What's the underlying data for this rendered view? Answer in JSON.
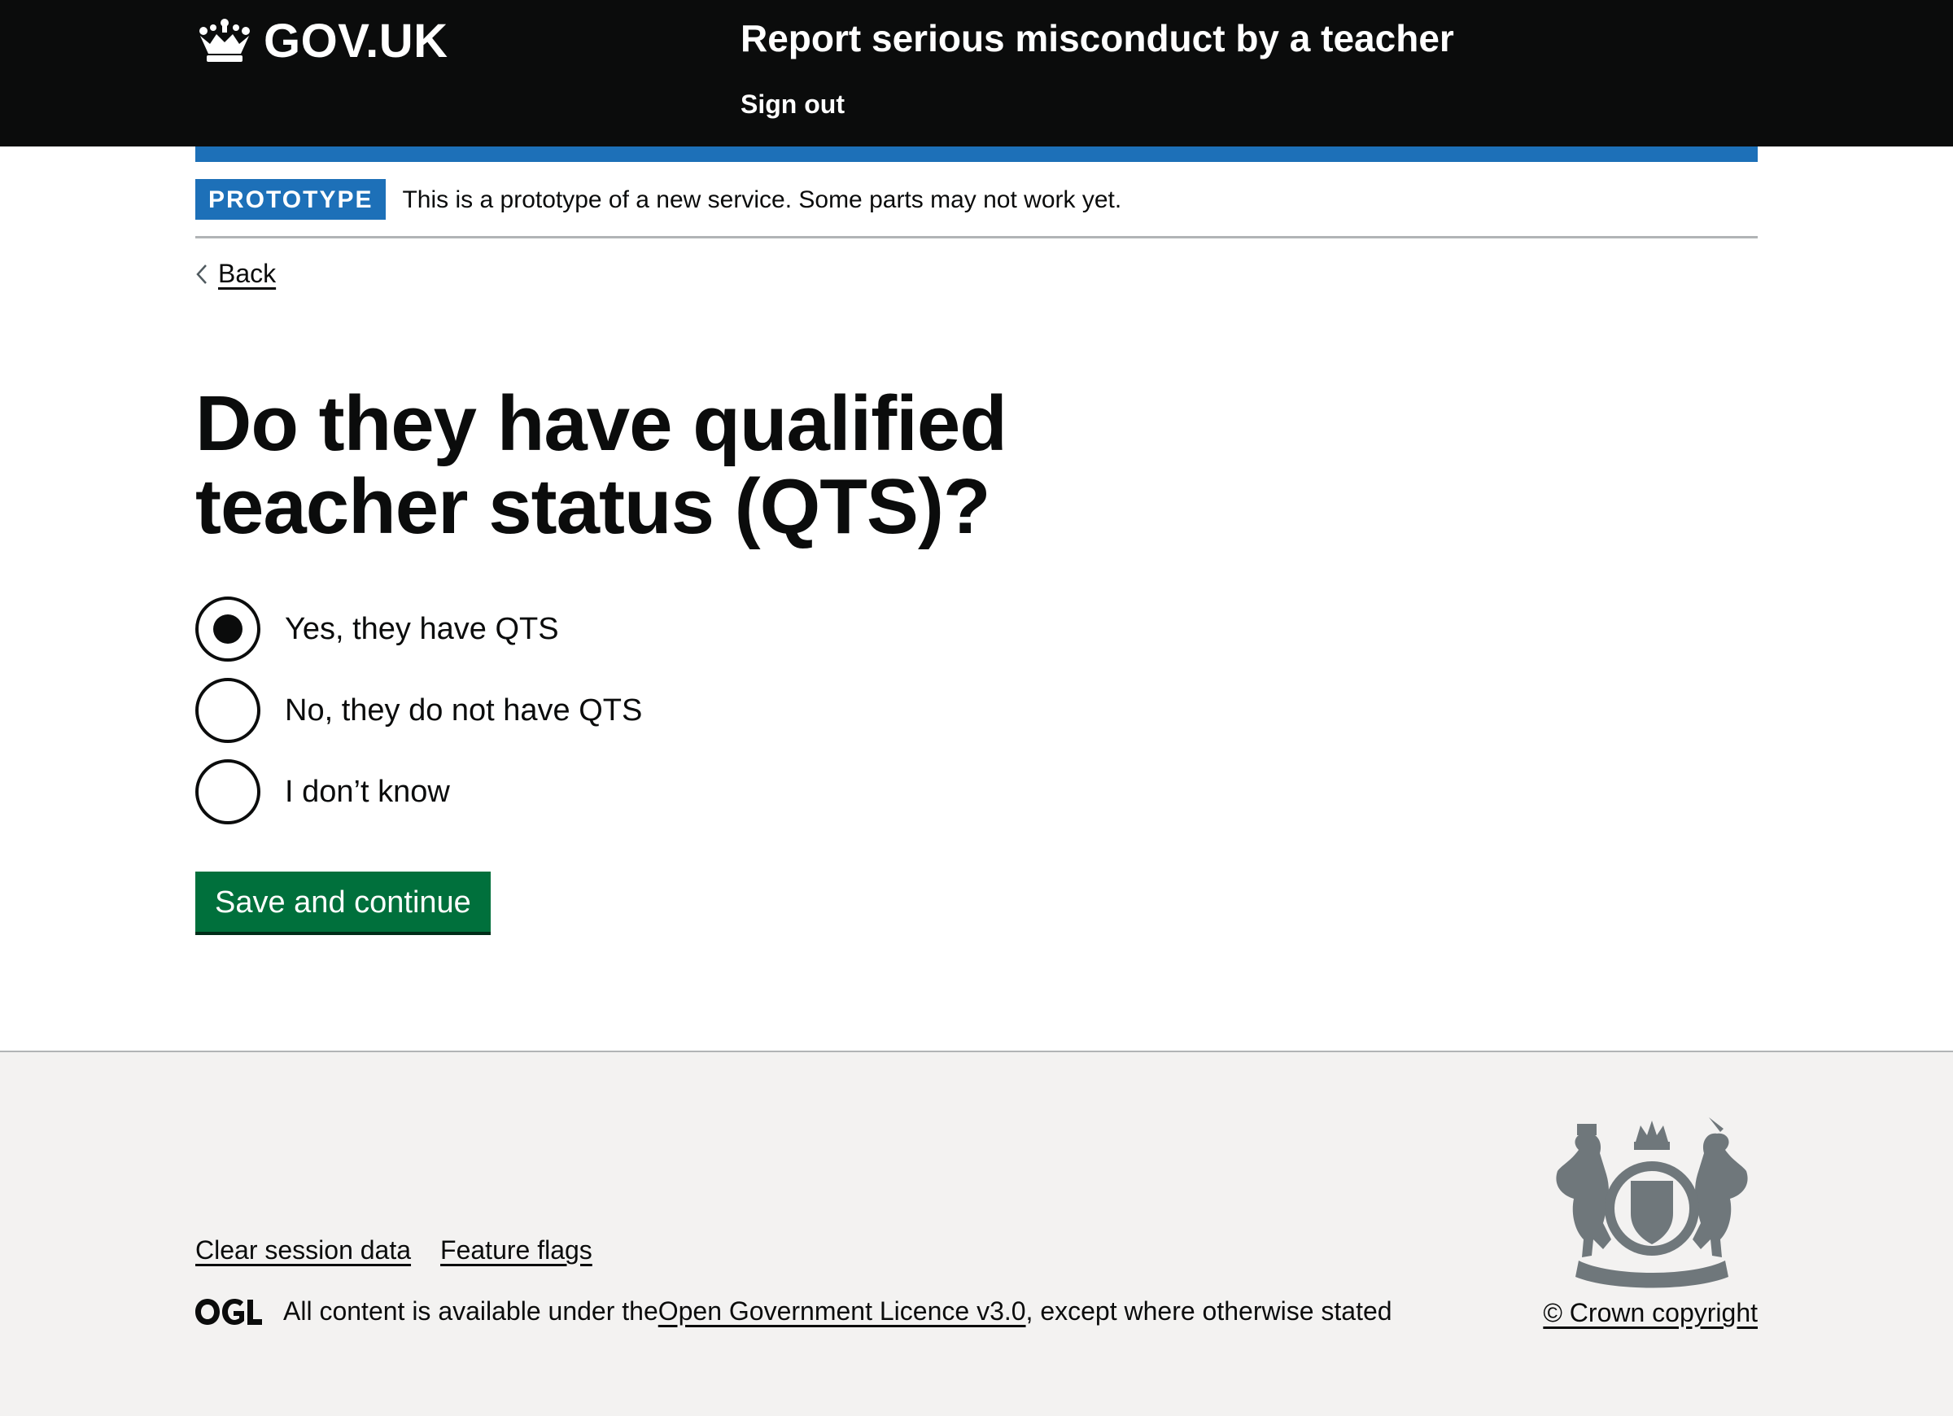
{
  "header": {
    "logo_text": "GOV.UK",
    "service_name": "Report serious misconduct by a teacher",
    "sign_out_label": "Sign out"
  },
  "phase_banner": {
    "tag": "PROTOTYPE",
    "text": "This is a prototype of a new service. Some parts may not work yet."
  },
  "back_link": {
    "label": "Back"
  },
  "question": {
    "title": "Do they have qualified teacher status (QTS)?",
    "options": [
      {
        "label": "Yes, they have QTS",
        "checked": true
      },
      {
        "label": "No, they do not have QTS",
        "checked": false
      },
      {
        "label": "I don’t know",
        "checked": false
      }
    ]
  },
  "actions": {
    "submit_label": "Save and continue"
  },
  "footer": {
    "links": [
      "Clear session data",
      "Feature flags"
    ],
    "ogl_label": "OGL",
    "licence_prefix": "All content is available under the ",
    "licence_link": "Open Government Licence v3.0",
    "licence_suffix": ", except where otherwise stated",
    "copyright": "© Crown copyright"
  },
  "colors": {
    "header_bg": "#0b0c0c",
    "brand_blue": "#1d70b8",
    "button_green": "#00703c",
    "footer_bg": "#f3f2f1"
  },
  "icons": [
    "crown-icon",
    "chevron-left-icon",
    "ogl-logo-icon",
    "royal-crest-icon"
  ]
}
